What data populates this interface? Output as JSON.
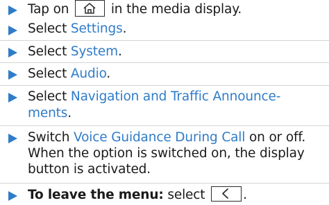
{
  "steps": [
    {
      "prefix": "Tap on",
      "icon": "home-icon",
      "suffix": "in the media display."
    },
    {
      "prefix": "Select",
      "link": "Settings",
      "suffix": "."
    },
    {
      "prefix": "Select",
      "link": "System",
      "suffix": "."
    },
    {
      "prefix": "Select",
      "link": "Audio",
      "suffix": "."
    },
    {
      "prefix": "Select",
      "link_line1": "Navigation and Traffic Announce-",
      "link_line2": "ments",
      "suffix": "."
    },
    {
      "prefix": "Switch",
      "link": "Voice Guidance During Call",
      "suffix": "on or off.",
      "line2": "When the option is switched on, the display",
      "line3": "button is activated."
    },
    {
      "bold": "To leave the menu:",
      "prefix": "select",
      "icon": "back-chevron-icon",
      "suffix": "."
    }
  ],
  "colors": {
    "accent": "#2f7cc9",
    "text": "#1a1a1a",
    "divider": "#d4d4d4"
  }
}
